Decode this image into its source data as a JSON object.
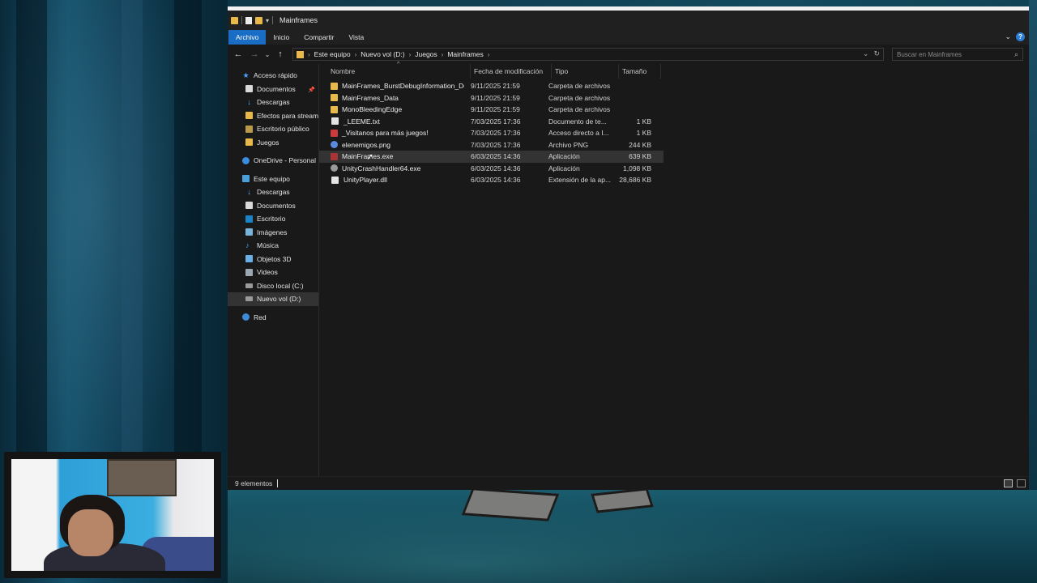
{
  "window": {
    "title": "Mainframes"
  },
  "ribbon": {
    "tabs": [
      "Archivo",
      "Inicio",
      "Compartir",
      "Vista"
    ],
    "help_label": "?"
  },
  "address": {
    "crumbs": [
      "Este equipo",
      "Nuevo vol (D:)",
      "Juegos",
      "Mainframes"
    ]
  },
  "search": {
    "placeholder": "Buscar en Mainframes"
  },
  "sidebar": {
    "quick_access": "Acceso rápido",
    "quick_items": [
      "Documentos",
      "Descargas",
      "Efectos para stream",
      "Escritorio público",
      "Juegos"
    ],
    "onedrive": "OneDrive - Personal",
    "this_pc": "Este equipo",
    "pc_items": [
      "Descargas",
      "Documentos",
      "Escritorio",
      "Imágenes",
      "Música",
      "Objetos 3D",
      "Videos",
      "Disco local (C:)",
      "Nuevo vol (D:)"
    ],
    "network": "Red"
  },
  "columns": {
    "name": "Nombre",
    "date": "Fecha de modificación",
    "type": "Tipo",
    "size": "Tamaño"
  },
  "files": [
    {
      "name": "MainFrames_BurstDebugInformation_Do...",
      "date": "9/11/2025 21:59",
      "type": "Carpeta de archivos",
      "size": "",
      "icon": "folder-icon"
    },
    {
      "name": "MainFrames_Data",
      "date": "9/11/2025 21:59",
      "type": "Carpeta de archivos",
      "size": "",
      "icon": "folder-icon"
    },
    {
      "name": "MonoBleedingEdge",
      "date": "9/11/2025 21:59",
      "type": "Carpeta de archivos",
      "size": "",
      "icon": "folder-icon"
    },
    {
      "name": "_LEEME.txt",
      "date": "7/03/2025 17:36",
      "type": "Documento de te...",
      "size": "1 KB",
      "icon": "text-file-icon"
    },
    {
      "name": "_Visitanos para más juegos!",
      "date": "7/03/2025 17:36",
      "type": "Acceso directo a I...",
      "size": "1 KB",
      "icon": "shortcut-icon"
    },
    {
      "name": "elenemigos.png",
      "date": "7/03/2025 17:36",
      "type": "Archivo PNG",
      "size": "244 KB",
      "icon": "image-file-icon"
    },
    {
      "name": "MainFrames.exe",
      "date": "6/03/2025 14:36",
      "type": "Aplicación",
      "size": "639 KB",
      "icon": "exe-file-icon"
    },
    {
      "name": "UnityCrashHandler64.exe",
      "date": "6/03/2025 14:36",
      "type": "Aplicación",
      "size": "1,098 KB",
      "icon": "crash-handler-icon"
    },
    {
      "name": "UnityPlayer.dll",
      "date": "6/03/2025 14:36",
      "type": "Extensión de la ap...",
      "size": "28,686 KB",
      "icon": "dll-file-icon"
    }
  ],
  "status": {
    "count": "9 elementos"
  },
  "colors": {
    "accent": "#1a6dc4",
    "window_bg": "#191919",
    "folder": "#e8b84a"
  }
}
